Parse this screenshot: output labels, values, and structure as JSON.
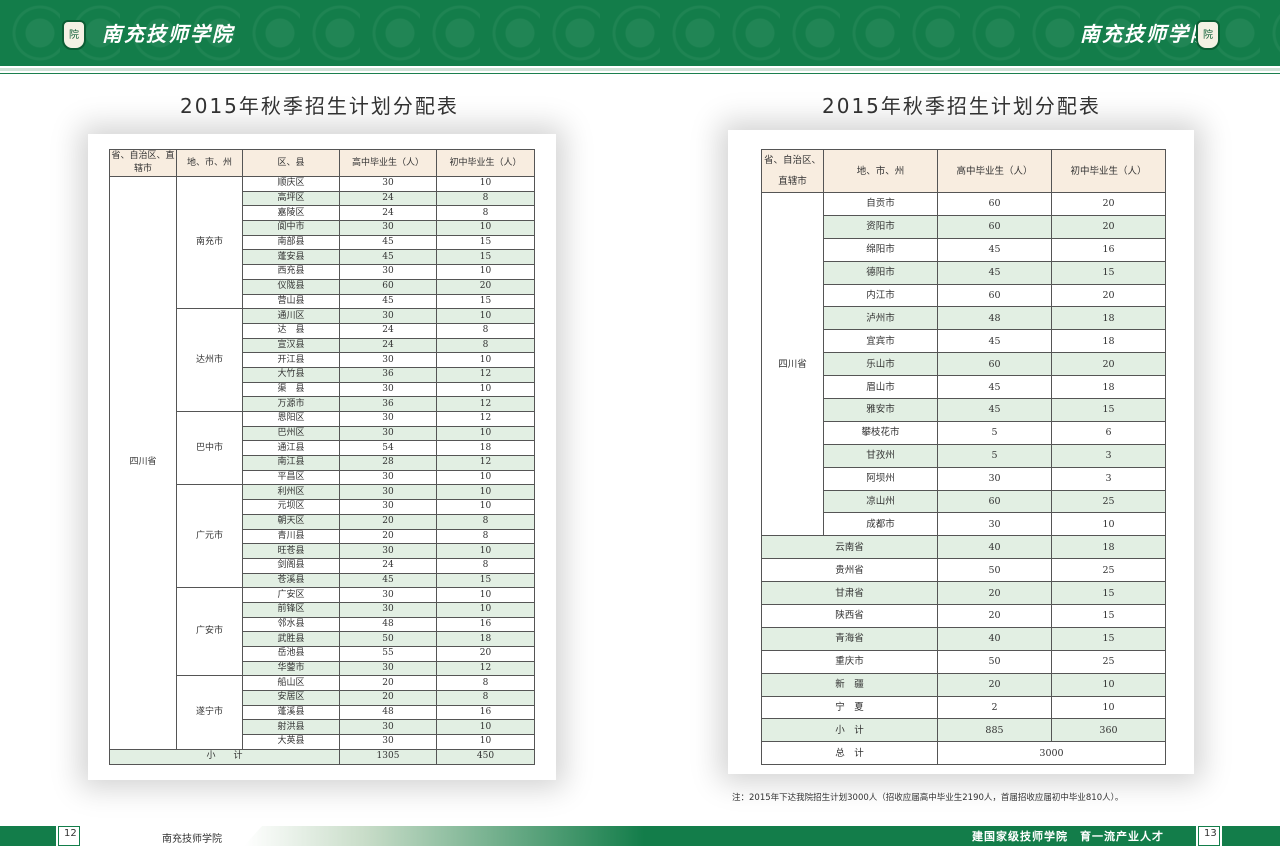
{
  "header": {
    "brand_left": "南充技师学院",
    "brand_right": "南充技师学院",
    "logo_glyph": "院",
    "accent_color": "#137d4a"
  },
  "left_page": {
    "title": "2015年秋季招生计划分配表",
    "headers": [
      "省、自治区、直辖市",
      "地、市、州",
      "区、县",
      "高中毕业生（人）",
      "初中毕业生（人）"
    ],
    "province": "四川省",
    "groups": [
      {
        "city": "南充市",
        "rows": [
          [
            "顺庆区",
            "30",
            "10"
          ],
          [
            "高坪区",
            "24",
            "8"
          ],
          [
            "嘉陵区",
            "24",
            "8"
          ],
          [
            "阆中市",
            "30",
            "10"
          ],
          [
            "南部县",
            "45",
            "15"
          ],
          [
            "蓬安县",
            "45",
            "15"
          ],
          [
            "西充县",
            "30",
            "10"
          ],
          [
            "仪陇县",
            "60",
            "20"
          ],
          [
            "营山县",
            "45",
            "15"
          ]
        ]
      },
      {
        "city": "达州市",
        "rows": [
          [
            "通川区",
            "30",
            "10"
          ],
          [
            "达　县",
            "24",
            "8"
          ],
          [
            "宣汉县",
            "24",
            "8"
          ],
          [
            "开江县",
            "30",
            "10"
          ],
          [
            "大竹县",
            "36",
            "12"
          ],
          [
            "渠　县",
            "30",
            "10"
          ],
          [
            "万源市",
            "36",
            "12"
          ]
        ]
      },
      {
        "city": "巴中市",
        "rows": [
          [
            "恩阳区",
            "30",
            "12"
          ],
          [
            "巴州区",
            "30",
            "10"
          ],
          [
            "通江县",
            "54",
            "18"
          ],
          [
            "南江县",
            "28",
            "12"
          ],
          [
            "平昌区",
            "30",
            "10"
          ]
        ]
      },
      {
        "city": "广元市",
        "rows": [
          [
            "利州区",
            "30",
            "10"
          ],
          [
            "元坝区",
            "30",
            "10"
          ],
          [
            "朝天区",
            "20",
            "8"
          ],
          [
            "青川县",
            "20",
            "8"
          ],
          [
            "旺苍县",
            "30",
            "10"
          ],
          [
            "剑阁县",
            "24",
            "8"
          ],
          [
            "苍溪县",
            "45",
            "15"
          ]
        ]
      },
      {
        "city": "广安市",
        "rows": [
          [
            "广安区",
            "30",
            "10"
          ],
          [
            "前锋区",
            "30",
            "10"
          ],
          [
            "邻水县",
            "48",
            "16"
          ],
          [
            "武胜县",
            "50",
            "18"
          ],
          [
            "岳池县",
            "55",
            "20"
          ],
          [
            "华蓥市",
            "30",
            "12"
          ]
        ]
      },
      {
        "city": "遂宁市",
        "rows": [
          [
            "船山区",
            "20",
            "8"
          ],
          [
            "安居区",
            "20",
            "8"
          ],
          [
            "蓬溪县",
            "48",
            "16"
          ],
          [
            "射洪县",
            "30",
            "10"
          ],
          [
            "大英县",
            "30",
            "10"
          ]
        ]
      }
    ],
    "subtotal": {
      "label": "小　　计",
      "high": "1305",
      "junior": "450"
    }
  },
  "right_page": {
    "title": "2015年秋季招生计划分配表",
    "headers": [
      "省、自治区、直辖市",
      "地、市、州",
      "高中毕业生（人）",
      "初中毕业生（人）"
    ],
    "province": "四川省",
    "sichuan_rows": [
      [
        "自贡市",
        "60",
        "20"
      ],
      [
        "资阳市",
        "60",
        "20"
      ],
      [
        "绵阳市",
        "45",
        "16"
      ],
      [
        "德阳市",
        "45",
        "15"
      ],
      [
        "内江市",
        "60",
        "20"
      ],
      [
        "泸州市",
        "48",
        "18"
      ],
      [
        "宜宾市",
        "45",
        "18"
      ],
      [
        "乐山市",
        "60",
        "20"
      ],
      [
        "眉山市",
        "45",
        "18"
      ],
      [
        "雅安市",
        "45",
        "15"
      ],
      [
        "攀枝花市",
        "5",
        "6"
      ],
      [
        "甘孜州",
        "5",
        "3"
      ],
      [
        "阿坝州",
        "30",
        "3"
      ],
      [
        "凉山州",
        "60",
        "25"
      ],
      [
        "成都市",
        "30",
        "10"
      ]
    ],
    "other_rows": [
      [
        "云南省",
        "40",
        "18"
      ],
      [
        "贵州省",
        "50",
        "25"
      ],
      [
        "甘肃省",
        "20",
        "15"
      ],
      [
        "陕西省",
        "20",
        "15"
      ],
      [
        "青海省",
        "40",
        "15"
      ],
      [
        "重庆市",
        "50",
        "25"
      ],
      [
        "新　疆",
        "20",
        "10"
      ],
      [
        "宁　夏",
        "2",
        "10"
      ]
    ],
    "subtotal": {
      "label": "小　计",
      "high": "885",
      "junior": "360"
    },
    "total": {
      "label": "总　计",
      "value": "3000"
    },
    "note": "注：2015年下达我院招生计划3000人（招收应届高中毕业生2190人，首届招收应届初中毕业810人）。"
  },
  "footer": {
    "left_page_num": "12",
    "left_label": "南充技师学院",
    "slogan": "建国家级技师学院　育一流产业人才",
    "right_page_num": "13"
  }
}
